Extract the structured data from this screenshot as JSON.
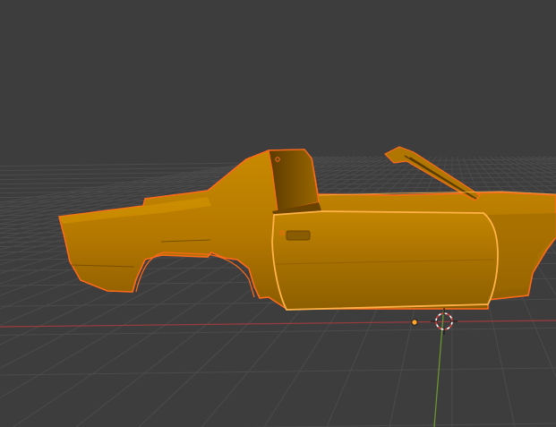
{
  "viewport": {
    "mode": "Object Mode",
    "selection": "car-body",
    "colors": {
      "background": "#3d3d3d",
      "grid": "#4a4a4a",
      "x_axis": "#9c3b3f",
      "y_axis": "#6f9b2e",
      "mesh_fill": "#c98400",
      "mesh_shade": "#a86c00",
      "mesh_dark": "#6a4300",
      "selection_outline": "#ff7a1a",
      "active_outline": "#ffb347",
      "origin_dot": "#ffa52a"
    },
    "icons": {
      "cursor": "3d-cursor-icon",
      "origin": "object-origin-icon"
    }
  }
}
